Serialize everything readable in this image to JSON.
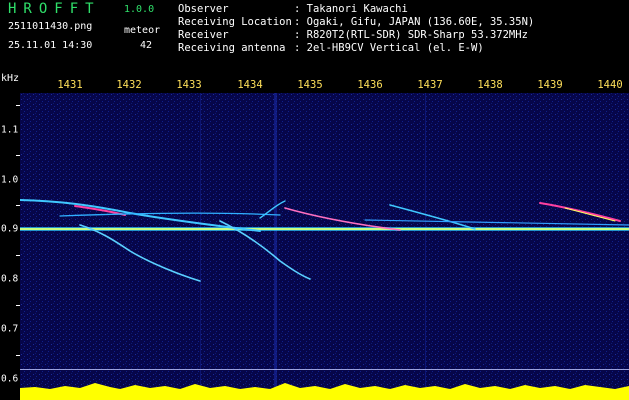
{
  "header": {
    "app_name": "HROFFT",
    "version": "1.0.0",
    "file_name": "2511011430.png",
    "timestamp": "25.11.01 14:30",
    "meteor_label": "meteor",
    "meteor_count": "42"
  },
  "info": [
    {
      "key": "Observer",
      "value": ": Takanori Kawachi"
    },
    {
      "key": "Receiving Location",
      "value": ": Ogaki, Gifu, JAPAN (136.60E, 35.35N)"
    },
    {
      "key": "Receiver",
      "value": ": R820T2(RTL-SDR) SDR-Sharp 53.372MHz"
    },
    {
      "key": "Receiving antenna",
      "value": ": 2el-HB9CV Vertical (el. E-W)"
    }
  ],
  "axis": {
    "freq_unit": "kHz",
    "minutes": [
      "1431",
      "1432",
      "1433",
      "1434",
      "1435",
      "1436",
      "1437",
      "1438",
      "1439",
      "1440"
    ],
    "freq_ticks": [
      "1.1",
      "1.0",
      "0.9",
      "0.8",
      "0.7",
      "0.6"
    ]
  },
  "colors": {
    "background": "#06064a",
    "title_green": "#2fe06a",
    "minute_yellow": "#ffe05a",
    "activity_yellow": "#ffff00",
    "carrier": "#c8ff80"
  }
}
